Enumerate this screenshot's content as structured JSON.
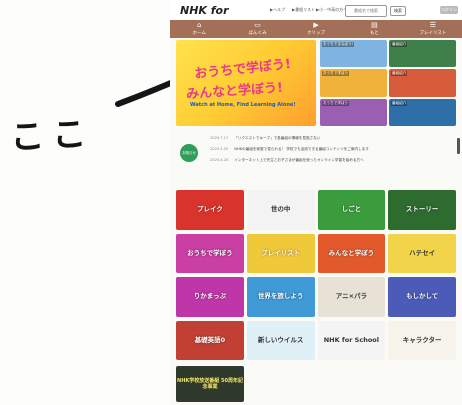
{
  "annotation": {
    "label": "ここ"
  },
  "header": {
    "logo": "NHK for",
    "mini_links": [
      "▶ヘルプ",
      "▶番組リスト",
      "▶小・中高の方へ"
    ],
    "search": "番組名で検索",
    "buttons": [
      "検索",
      "ログイン"
    ]
  },
  "nav": {
    "items": [
      {
        "label": "ホーム",
        "icon": "home-icon"
      },
      {
        "label": "ばんぐみ",
        "icon": "tv-icon"
      },
      {
        "label": "クリップ",
        "icon": "clip-icon"
      },
      {
        "label": "もと",
        "icon": "book-icon"
      },
      {
        "label": "プレイリスト",
        "icon": "playlist-icon"
      }
    ]
  },
  "hero": {
    "line1": "おうちで学ぼう!",
    "line2": "みんなと学ぼう!",
    "subtitle": "Watch at Home, Find Learning Alone!",
    "thumbs": [
      "おうちでまなぼう!",
      "番組紹介",
      "おうちで学ぼう",
      "番組紹介",
      "おうちで学ぼう",
      "番組紹介"
    ]
  },
  "notices": {
    "badge": "お知らせ",
    "items": [
      {
        "date": "2020.7.17",
        "text": "「リクエストでキープ」で各番組の情報を見逃さない"
      },
      {
        "date": "2020.4.20",
        "text": "NHKの番組を家庭で見られる！ 学校でも活用できる番組コンテンツをご案内します"
      },
      {
        "date": "2020.4.20",
        "text": "インターネット上で先生とお子さまが番組を使ったオンライン学習を始める方へ"
      }
    ]
  },
  "tiles": [
    {
      "label": "プレイク",
      "color": "#d8342c",
      "dark": false
    },
    {
      "label": "世の中",
      "color": "#f3f3f3",
      "dark": true
    },
    {
      "label": "しごと",
      "color": "#3b9c3d",
      "dark": false
    },
    {
      "label": "ストーリー",
      "color": "#2d6b2f",
      "dark": false
    },
    {
      "label": "おうちで学ぼう",
      "color": "#c93fa3",
      "dark": false
    },
    {
      "label": "プレイリスト",
      "color": "#f0c93b",
      "dark": false
    },
    {
      "label": "みんなと学ぼう",
      "color": "#e25a2c",
      "dark": false
    },
    {
      "label": "ハテセイ",
      "color": "#f2d44a",
      "dark": true
    },
    {
      "label": "りかまっぷ",
      "color": "#bf36a8",
      "dark": false
    },
    {
      "label": "世界を旅しよう",
      "color": "#3f9ad6",
      "dark": false
    },
    {
      "label": "アニ×パラ",
      "color": "#e8e2d6",
      "dark": true
    },
    {
      "label": "もしかして",
      "color": "#4c5bb8",
      "dark": false
    },
    {
      "label": "基礎英語0",
      "color": "#c23f33",
      "dark": false
    },
    {
      "label": "新しいウイルス",
      "color": "#dff0f7",
      "dark": true
    },
    {
      "label": "NHK for School",
      "color": "#f4f4f4",
      "dark": true
    },
    {
      "label": "キャラクター",
      "color": "#f6f3ea",
      "dark": true
    }
  ],
  "last_tile": {
    "label": "NHK学校放送番組 50周年記念事業"
  }
}
